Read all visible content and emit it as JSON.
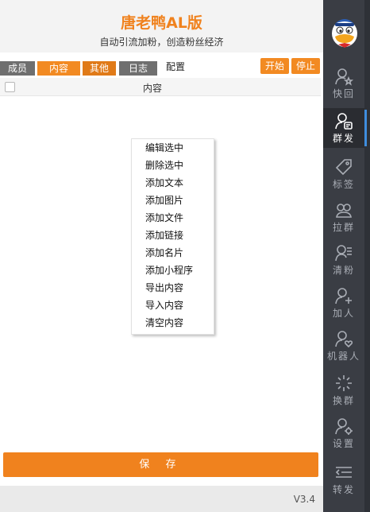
{
  "app": {
    "title": "唐老鸭AL版",
    "subtitle": "自动引流加粉，创造粉丝经济"
  },
  "tabs": [
    {
      "label": "成员"
    },
    {
      "label": "内容"
    },
    {
      "label": "其他"
    },
    {
      "label": "日志"
    }
  ],
  "toolbar": {
    "config_label": "配置",
    "start_label": "开始",
    "stop_label": "停止"
  },
  "table": {
    "column_content": "内容"
  },
  "context_menu": {
    "items": [
      "编辑选中",
      "删除选中",
      "添加文本",
      "添加图片",
      "添加文件",
      "添加链接",
      "添加名片",
      "添加小程序",
      "导出内容",
      "导入内容",
      "清空内容"
    ]
  },
  "save_button": {
    "label": "保 存"
  },
  "footer": {
    "version": "V3.4"
  },
  "sidebar": {
    "items": [
      {
        "label": "快回",
        "icon": "user-star-icon"
      },
      {
        "label": "群发",
        "icon": "user-message-icon",
        "active": true
      },
      {
        "label": "标签",
        "icon": "tag-icon"
      },
      {
        "label": "拉群",
        "icon": "group-icon"
      },
      {
        "label": "清粉",
        "icon": "user-list-icon"
      },
      {
        "label": "加人",
        "icon": "user-add-icon"
      },
      {
        "label": "机器人",
        "icon": "user-heart-icon"
      },
      {
        "label": "换群",
        "icon": "sparkle-icon"
      },
      {
        "label": "设置",
        "icon": "user-gear-icon"
      },
      {
        "label": "转发",
        "icon": "forward-list-icon"
      }
    ]
  },
  "colors": {
    "accent": "#f0821e",
    "sidebar": "#3a3d44",
    "active_indicator": "#3f8ede"
  }
}
